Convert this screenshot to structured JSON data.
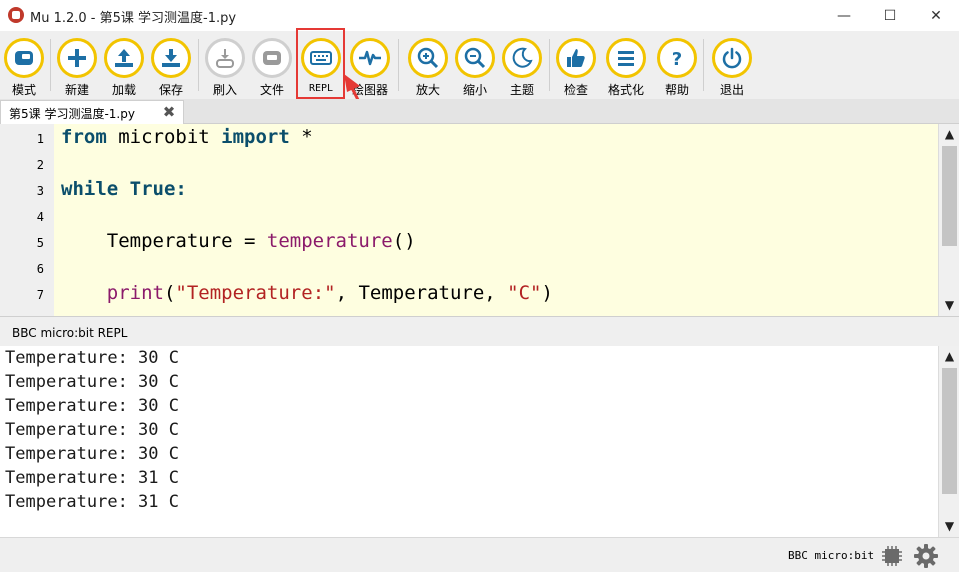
{
  "window": {
    "title": "Mu 1.2.0 - 第5课 学习测温度-1.py",
    "min_symbol": "—",
    "max_symbol": "☐",
    "close_symbol": "✕"
  },
  "toolbar": {
    "buttons": [
      {
        "id": "mode",
        "label": "模式",
        "icon": "mode-icon"
      },
      {
        "id": "new",
        "label": "新建",
        "icon": "plus-icon"
      },
      {
        "id": "load",
        "label": "加载",
        "icon": "upload-icon"
      },
      {
        "id": "save",
        "label": "保存",
        "icon": "download-icon"
      },
      {
        "id": "flash",
        "label": "刷入",
        "icon": "flash-icon"
      },
      {
        "id": "files",
        "label": "文件",
        "icon": "files-icon"
      },
      {
        "id": "repl",
        "label": "REPL",
        "icon": "keyboard-icon"
      },
      {
        "id": "plotter",
        "label": "绘图器",
        "icon": "pulse-icon"
      },
      {
        "id": "zoom_in",
        "label": "放大",
        "icon": "zoom-in-icon"
      },
      {
        "id": "zoom_out",
        "label": "缩小",
        "icon": "zoom-out-icon"
      },
      {
        "id": "theme",
        "label": "主题",
        "icon": "moon-icon"
      },
      {
        "id": "check",
        "label": "检查",
        "icon": "thumbs-up-icon"
      },
      {
        "id": "tidy",
        "label": "格式化",
        "icon": "lines-icon"
      },
      {
        "id": "help",
        "label": "帮助",
        "icon": "question-icon"
      },
      {
        "id": "quit",
        "label": "退出",
        "icon": "power-icon"
      }
    ]
  },
  "tab": {
    "label": "第5课 学习测温度-1.py",
    "close_symbol": "✖"
  },
  "editor": {
    "line_numbers": [
      "1",
      "2",
      "3",
      "4",
      "5",
      "6",
      "7"
    ],
    "code": {
      "l1_kw1": "from",
      "l1_mid": " microbit ",
      "l1_kw2": "import",
      "l1_end": " *",
      "l3_kw1": "while",
      "l3_sp": " ",
      "l3_kw2": "True",
      "l3_end": ":",
      "l5_a": "    Temperature = ",
      "l5_fn": "temperature",
      "l5_b": "()",
      "l7_ind": "    ",
      "l7_fn": "print",
      "l7_p1": "(",
      "l7_s1": "\"Temperature:\"",
      "l7_mid": ", Temperature, ",
      "l7_s2": "\"C\"",
      "l7_p2": ")"
    }
  },
  "repl": {
    "title": "BBC micro:bit REPL",
    "lines": [
      "Temperature: 30 C",
      "Temperature: 30 C",
      "Temperature: 30 C",
      "Temperature: 30 C",
      "Temperature: 30 C",
      "Temperature: 31 C",
      "Temperature: 31 C"
    ]
  },
  "statusbar": {
    "mode": "BBC micro:bit"
  },
  "colors": {
    "accent_yellow": "#f2c400",
    "icon_blue": "#1d6fa5",
    "highlight_red": "#e53935",
    "editor_bg": "#fefee0"
  }
}
